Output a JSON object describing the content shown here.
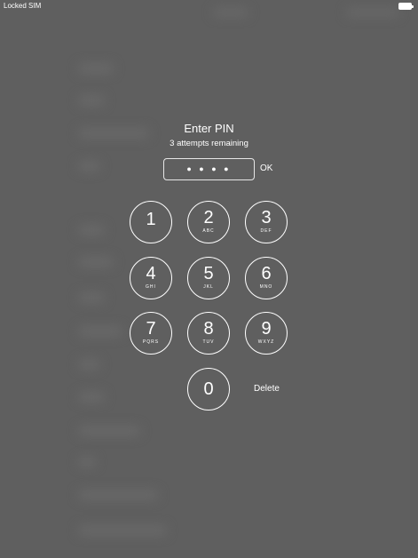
{
  "status_bar": {
    "carrier": "Locked SIM",
    "battery_icon": "battery-icon"
  },
  "prompt": {
    "title": "Enter PIN",
    "subtitle": "3 attempts remaining"
  },
  "pin_field": {
    "value": "● ● ● ●"
  },
  "actions": {
    "ok_label": "OK",
    "delete_label": "Delete"
  },
  "keypad": [
    {
      "digit": "1",
      "letters": ""
    },
    {
      "digit": "2",
      "letters": "ABC"
    },
    {
      "digit": "3",
      "letters": "DEF"
    },
    {
      "digit": "4",
      "letters": "GHI"
    },
    {
      "digit": "5",
      "letters": "JKL"
    },
    {
      "digit": "6",
      "letters": "MNO"
    },
    {
      "digit": "7",
      "letters": "PQRS"
    },
    {
      "digit": "8",
      "letters": "TUV"
    },
    {
      "digit": "9",
      "letters": "WXYZ"
    },
    {
      "digit": "0",
      "letters": ""
    }
  ],
  "colors": {
    "background": "#5f5f5f",
    "foreground": "#ffffff"
  }
}
